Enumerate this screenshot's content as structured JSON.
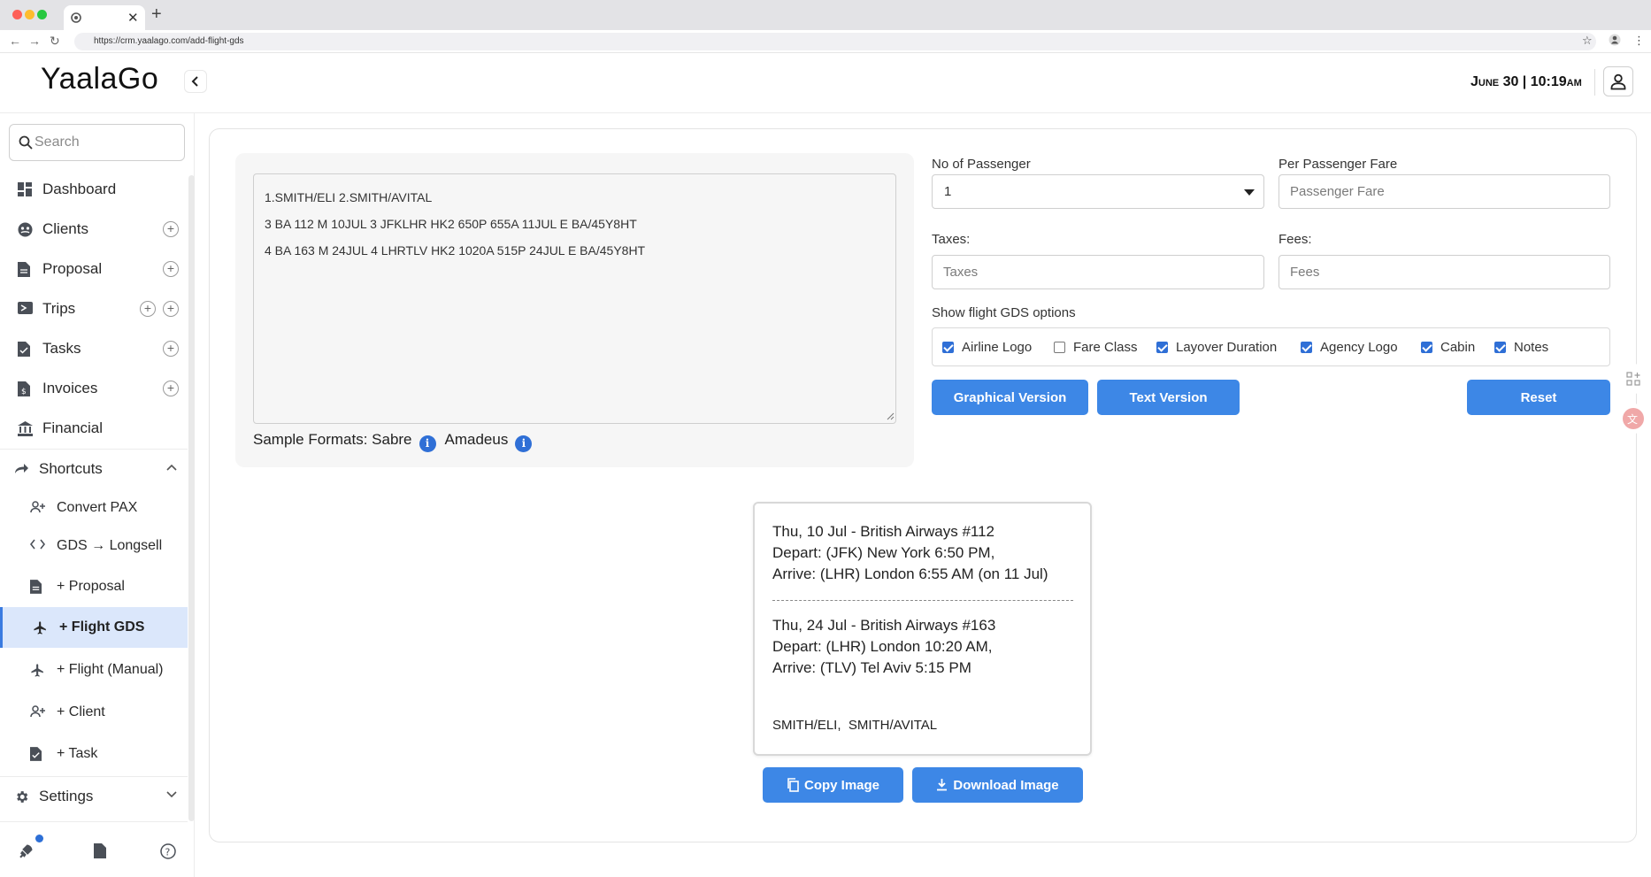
{
  "browser": {
    "url": "https://crm.yaalago.com/add-flight-gds",
    "tab_close": "✕",
    "new_tab": "+"
  },
  "header": {
    "logo": "YaalaGo",
    "datetime": "June 30 | 10:19am"
  },
  "sidebar": {
    "search_placeholder": "Search",
    "items": [
      {
        "label": "Dashboard",
        "icon": "dashboard-icon"
      },
      {
        "label": "Clients",
        "icon": "clients-icon"
      },
      {
        "label": "Proposal",
        "icon": "document-icon"
      },
      {
        "label": "Trips",
        "icon": "ticket-icon"
      },
      {
        "label": "Tasks",
        "icon": "task-icon"
      },
      {
        "label": "Invoices",
        "icon": "invoice-icon"
      },
      {
        "label": "Financial",
        "icon": "bank-icon"
      }
    ],
    "shortcuts_label": "Shortcuts",
    "shortcuts": [
      {
        "label": "Convert PAX"
      },
      {
        "label": "GDS → Longsell"
      },
      {
        "label": "+ Proposal"
      },
      {
        "label": "+ Flight GDS"
      },
      {
        "label": "+ Flight (Manual)"
      },
      {
        "label": "+ Client"
      },
      {
        "label": "+ Task"
      }
    ],
    "settings_label": "Settings"
  },
  "gds_input": {
    "lines": [
      "1.SMITH/ELI 2.SMITH/AVITAL",
      "3 BA 112 M 10JUL 3 JFKLHR HK2 650P 655A 11JUL E BA/45Y8HT",
      "4 BA 163 M 24JUL 4 LHRTLV HK2 1020A 515P 24JUL E BA/45Y8HT"
    ],
    "sample_formats_label": "Sample Formats: Sabre",
    "amadeus_label": "Amadeus",
    "info_glyph": "i"
  },
  "form": {
    "passengers_label": "No of Passenger",
    "passengers_value": "1",
    "fare_label": "Per Passenger Fare",
    "fare_placeholder": "Passenger Fare",
    "taxes_label": "Taxes:",
    "taxes_placeholder": "Taxes",
    "fees_label": "Fees:",
    "fees_placeholder": "Fees",
    "options_label": "Show flight GDS options",
    "options": [
      {
        "label": "Airline Logo",
        "checked": true
      },
      {
        "label": "Fare Class",
        "checked": false
      },
      {
        "label": "Layover Duration",
        "checked": true
      },
      {
        "label": "Agency Logo",
        "checked": true
      },
      {
        "label": "Cabin",
        "checked": true
      },
      {
        "label": "Notes",
        "checked": true
      }
    ],
    "graphical_btn": "Graphical Version",
    "text_btn": "Text Version",
    "reset_btn": "Reset"
  },
  "preview": {
    "segments": [
      {
        "title": "Thu, 10 Jul - British Airways #112",
        "depart": "Depart: (JFK) New York 6:50 PM,",
        "arrive": "Arrive: (LHR) London 6:55 AM (on 11 Jul)"
      },
      {
        "title": "Thu, 24 Jul - British Airways #163",
        "depart": "Depart: (LHR) London 10:20 AM,",
        "arrive": "Arrive: (TLV) Tel Aviv 5:15 PM"
      }
    ],
    "passengers": "SMITH/ELI,  SMITH/AVITAL",
    "copy_btn": "Copy Image",
    "download_btn": "Download Image"
  },
  "colors": {
    "primary": "#3d87e6",
    "active_bg": "#dbe7fb",
    "checkbox": "#2f6fd6"
  }
}
